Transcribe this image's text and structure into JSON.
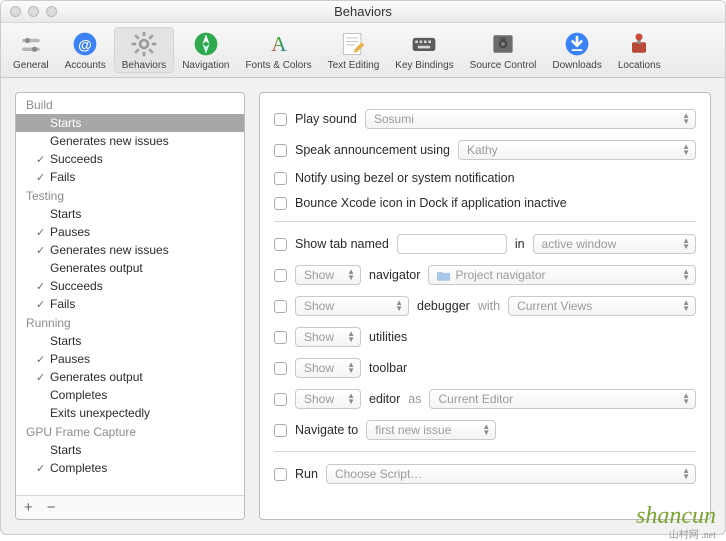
{
  "window": {
    "title": "Behaviors"
  },
  "toolbar": [
    {
      "id": "general",
      "label": "General"
    },
    {
      "id": "accounts",
      "label": "Accounts"
    },
    {
      "id": "behaviors",
      "label": "Behaviors",
      "active": true
    },
    {
      "id": "navigation",
      "label": "Navigation"
    },
    {
      "id": "fonts",
      "label": "Fonts & Colors"
    },
    {
      "id": "text",
      "label": "Text Editing"
    },
    {
      "id": "keys",
      "label": "Key Bindings"
    },
    {
      "id": "source",
      "label": "Source Control"
    },
    {
      "id": "downloads",
      "label": "Downloads"
    },
    {
      "id": "locations",
      "label": "Locations"
    }
  ],
  "sidebar": {
    "groups": [
      {
        "name": "Build",
        "items": [
          {
            "label": "Starts",
            "checked": false,
            "selected": true
          },
          {
            "label": "Generates new issues",
            "checked": false
          },
          {
            "label": "Succeeds",
            "checked": true
          },
          {
            "label": "Fails",
            "checked": true
          }
        ]
      },
      {
        "name": "Testing",
        "items": [
          {
            "label": "Starts",
            "checked": false
          },
          {
            "label": "Pauses",
            "checked": true
          },
          {
            "label": "Generates new issues",
            "checked": true
          },
          {
            "label": "Generates output",
            "checked": false
          },
          {
            "label": "Succeeds",
            "checked": true
          },
          {
            "label": "Fails",
            "checked": true
          }
        ]
      },
      {
        "name": "Running",
        "items": [
          {
            "label": "Starts",
            "checked": false
          },
          {
            "label": "Pauses",
            "checked": true
          },
          {
            "label": "Generates output",
            "checked": true
          },
          {
            "label": "Completes",
            "checked": false
          },
          {
            "label": "Exits unexpectedly",
            "checked": false
          }
        ]
      },
      {
        "name": "GPU Frame Capture",
        "items": [
          {
            "label": "Starts",
            "checked": false
          },
          {
            "label": "Completes",
            "checked": true
          }
        ]
      }
    ],
    "footer": {
      "add": "+",
      "remove": "−"
    }
  },
  "detail": {
    "playSound": {
      "label": "Play sound",
      "value": "Sosumi"
    },
    "speak": {
      "label": "Speak announcement using",
      "value": "Kathy"
    },
    "notify": {
      "label": "Notify using bezel or system notification"
    },
    "bounce": {
      "label": "Bounce Xcode icon in Dock if application inactive"
    },
    "tab": {
      "label": "Show tab named",
      "in": "in",
      "value": "active window"
    },
    "navigator": {
      "show": "Show",
      "label": "navigator",
      "value": "Project navigator"
    },
    "debugger": {
      "show": "Show",
      "label": "debugger",
      "with": "with",
      "value": "Current Views"
    },
    "utilities": {
      "show": "Show",
      "label": "utilities"
    },
    "toolbarRow": {
      "show": "Show",
      "label": "toolbar"
    },
    "editor": {
      "show": "Show",
      "label": "editor",
      "as": "as",
      "value": "Current Editor"
    },
    "navigate": {
      "label": "Navigate to",
      "value": "first new issue"
    },
    "run": {
      "label": "Run",
      "value": "Choose Script…"
    }
  },
  "watermark": {
    "text": "shancun",
    "sub": "山村网 .net"
  }
}
